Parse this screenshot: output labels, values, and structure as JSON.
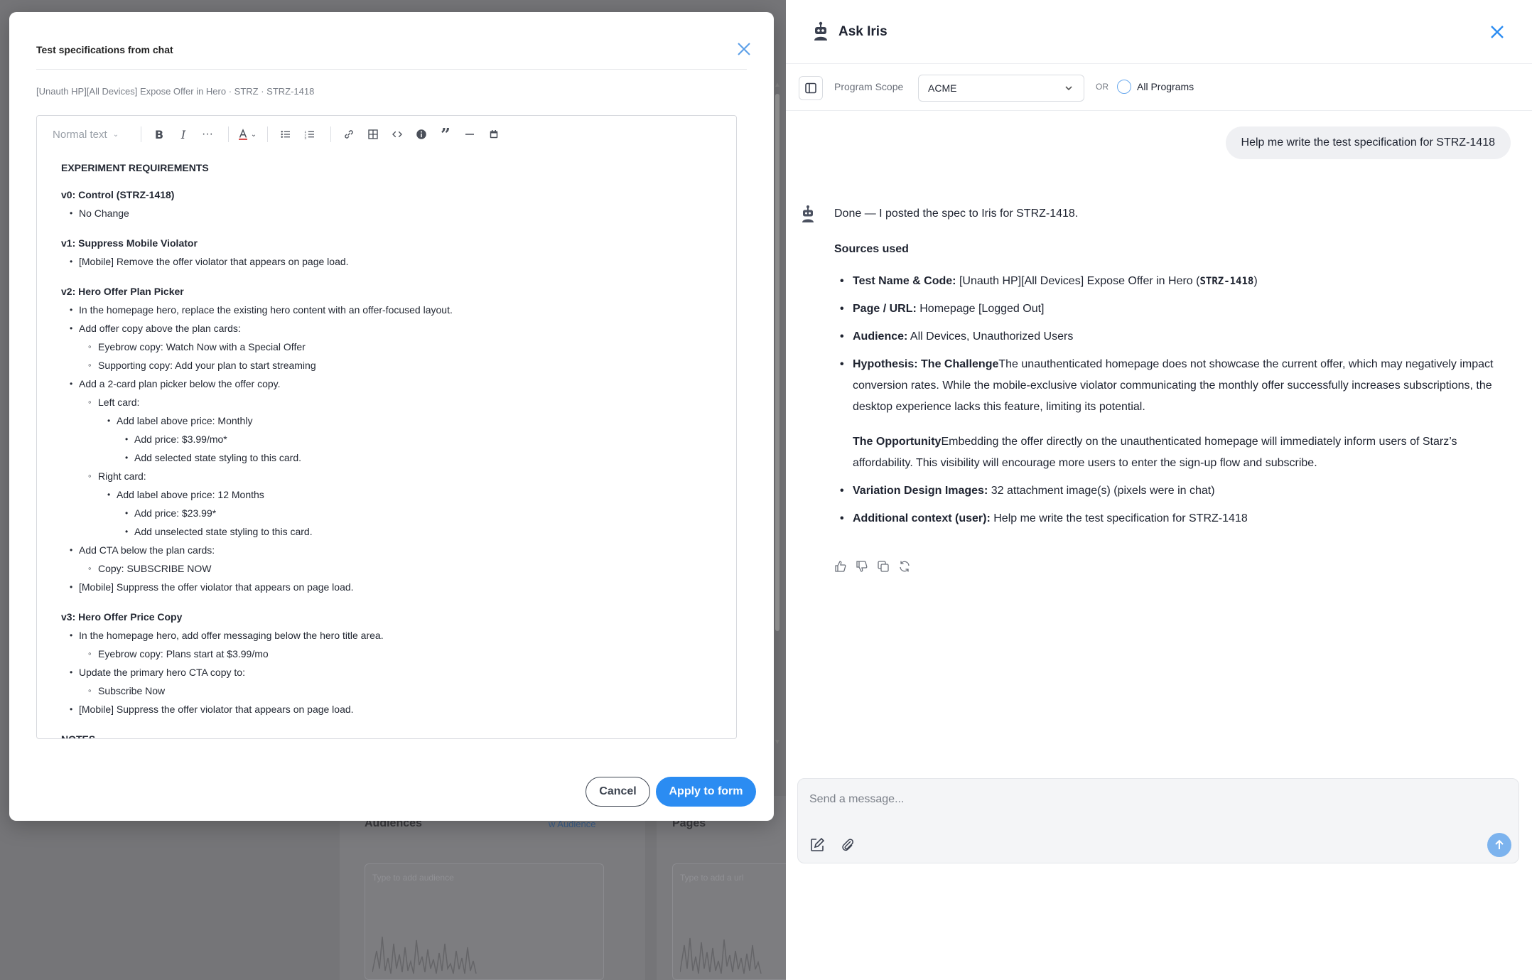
{
  "background": {
    "audiences_heading": "Audiences",
    "audience_link": "w Audience",
    "pages_heading": "Pages",
    "hint1": "Type to add audience",
    "hint2": "Type to add a url"
  },
  "modal": {
    "title": "Test specifications from chat",
    "subtitle": "[Unauth HP][All Devices] Expose Offer in Hero · STRZ · STRZ-1418",
    "toolbar": {
      "style_label": "Normal text"
    },
    "doc": {
      "heading": "EXPERIMENT REQUIREMENTS",
      "sections": [
        {
          "title": "v0: Control (STRZ-1418)",
          "items": [
            {
              "level": 1,
              "text": "No Change"
            }
          ]
        },
        {
          "title": "v1: Suppress Mobile Violator",
          "items": [
            {
              "level": 1,
              "text": "[Mobile] Remove the offer violator that appears on page load."
            }
          ]
        },
        {
          "title": "v2: Hero Offer Plan Picker",
          "items": [
            {
              "level": 1,
              "text": "In the homepage hero, replace the existing hero content with an offer-focused layout."
            },
            {
              "level": 1,
              "text": "Add offer copy above the plan cards:"
            },
            {
              "level": 2,
              "text": "Eyebrow copy: Watch Now with a Special Offer"
            },
            {
              "level": 2,
              "text": "Supporting copy: Add your plan to start streaming"
            },
            {
              "level": 1,
              "text": "Add a 2-card plan picker below the offer copy."
            },
            {
              "level": 2,
              "text": "Left card:"
            },
            {
              "level": 3,
              "text": "Add label above price: Monthly"
            },
            {
              "level": 4,
              "text": "Add price: $3.99/mo*"
            },
            {
              "level": 4,
              "text": "Add selected state styling to this card."
            },
            {
              "level": 2,
              "text": "Right card:"
            },
            {
              "level": 3,
              "text": "Add label above price: 12 Months"
            },
            {
              "level": 4,
              "text": "Add price: $23.99*"
            },
            {
              "level": 4,
              "text": "Add unselected state styling to this card."
            },
            {
              "level": 1,
              "text": "Add CTA below the plan cards:"
            },
            {
              "level": 2,
              "text": "Copy: SUBSCRIBE NOW"
            },
            {
              "level": 1,
              "text": "[Mobile] Suppress the offer violator that appears on page load."
            }
          ]
        },
        {
          "title": "v3: Hero Offer Price Copy",
          "items": [
            {
              "level": 1,
              "text": "In the homepage hero, add offer messaging below the hero title area."
            },
            {
              "level": 2,
              "text": "Eyebrow copy: Plans start at $3.99/mo"
            },
            {
              "level": 1,
              "text": "Update the primary hero CTA copy to:"
            },
            {
              "level": 2,
              "text": "Subscribe Now"
            },
            {
              "level": 1,
              "text": "[Mobile] Suppress the offer violator that appears on page load."
            }
          ]
        },
        {
          "title": "NOTES",
          "items": []
        }
      ]
    },
    "cancel_label": "Cancel",
    "apply_label": "Apply to form"
  },
  "iris": {
    "title": "Ask Iris",
    "scope_label": "Program Scope",
    "scope_value": "ACME",
    "or_label": "OR",
    "all_programs_label": "All Programs",
    "user_message": "Help me write the test specification for STRZ-1418",
    "bot": {
      "intro": "Done — I posted the spec to Iris for STRZ-1418.",
      "sources_heading": "Sources used",
      "test_name_label": "Test Name & Code:",
      "test_name_value": "[Unauth HP][All Devices] Expose Offer in Hero (",
      "test_code": "STRZ-1418",
      "test_name_close": ")",
      "page_label": "Page / URL:",
      "page_value": "Homepage [Logged Out]",
      "audience_label": "Audience:",
      "audience_value": "All Devices, Unauthorized Users",
      "hypothesis_label": "Hypothesis: The Challenge",
      "hypothesis_value": "The unauthenticated homepage does not showcase the current offer, which may negatively impact conversion rates. While the mobile-exclusive violator communicating the monthly offer successfully increases subscriptions, the desktop experience lacks this feature, limiting its potential.",
      "opportunity_label": "The Opportunity",
      "opportunity_value": "Embedding the offer directly on the unauthenticated homepage will immediately inform users of Starz’s affordability. This visibility will encourage more users to enter the sign-up flow and subscribe.",
      "images_label": "Variation Design Images:",
      "images_value": "32 attachment image(s) (pixels were in chat)",
      "context_label": "Additional context (user):",
      "context_value": "Help me write the test specification for STRZ-1418"
    },
    "composer_placeholder": "Send a message..."
  },
  "colors": {
    "accent": "#2b8cf2",
    "send_button": "#7cb3ee",
    "overlay": "#757578"
  }
}
